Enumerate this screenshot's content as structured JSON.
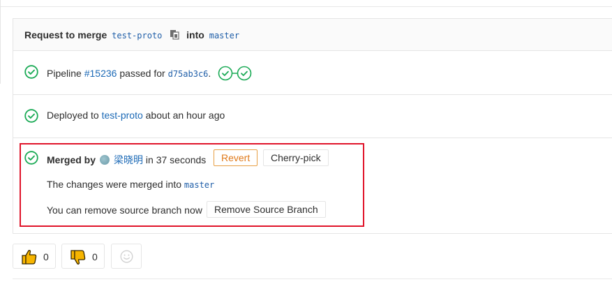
{
  "header": {
    "prefix": "Request to merge",
    "source_branch": "test-proto",
    "middle": "into",
    "target_branch": "master"
  },
  "pipeline": {
    "prefix": "Pipeline",
    "id": "#15236",
    "middle": "passed for",
    "commit": "d75ab3c6",
    "suffix": "."
  },
  "deploy": {
    "prefix": "Deployed to",
    "environment": "test-proto",
    "suffix": "about an hour ago"
  },
  "merged": {
    "label": "Merged by",
    "user": "梁晓明",
    "duration": "in 37 seconds",
    "revert_label": "Revert",
    "cherry_pick_label": "Cherry-pick",
    "changes_text": "The changes were merged into",
    "changes_branch": "master",
    "remove_text": "You can remove source branch now",
    "remove_button_label": "Remove Source Branch"
  },
  "awards": {
    "thumbs_up_count": "0",
    "thumbs_down_count": "0"
  },
  "colors": {
    "success": "#1aaa55",
    "link": "#1b69b6",
    "revert": "#e07a1a",
    "highlight": "#e0142a"
  },
  "icons": [
    "check-circle-icon",
    "clipboard-icon",
    "pipeline-stage-icon",
    "thumbs-up-icon",
    "thumbs-down-icon",
    "smiley-icon",
    "avatar"
  ]
}
